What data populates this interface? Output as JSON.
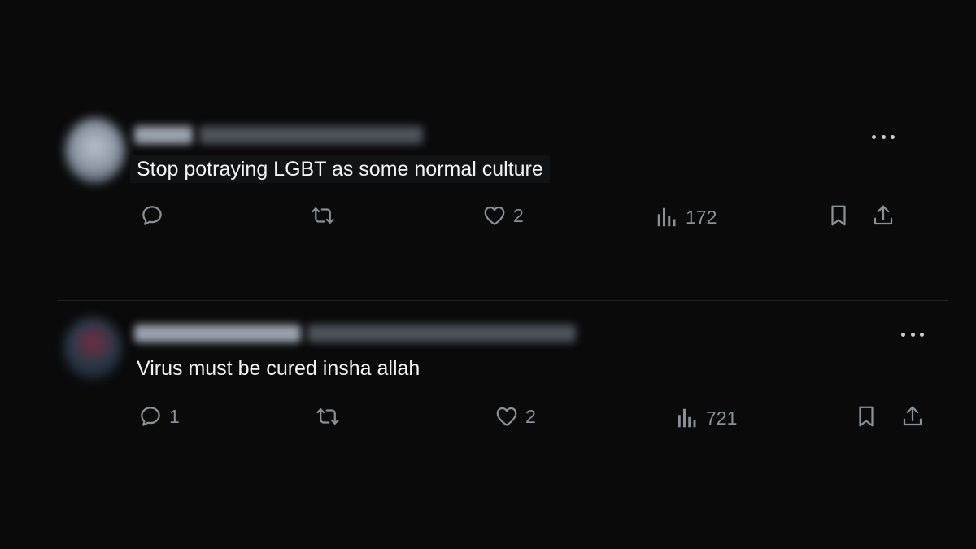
{
  "tweets": [
    {
      "text": "Stop potraying LGBT as some normal culture",
      "reply_count": "",
      "like_count": "2",
      "view_count": "172"
    },
    {
      "text": "Virus must be cured insha allah",
      "reply_count": "1",
      "like_count": "2",
      "view_count": "721"
    }
  ],
  "colors": {
    "background": "#0a0a0b",
    "text": "#e7e9ea",
    "icon": "#8b9096"
  }
}
